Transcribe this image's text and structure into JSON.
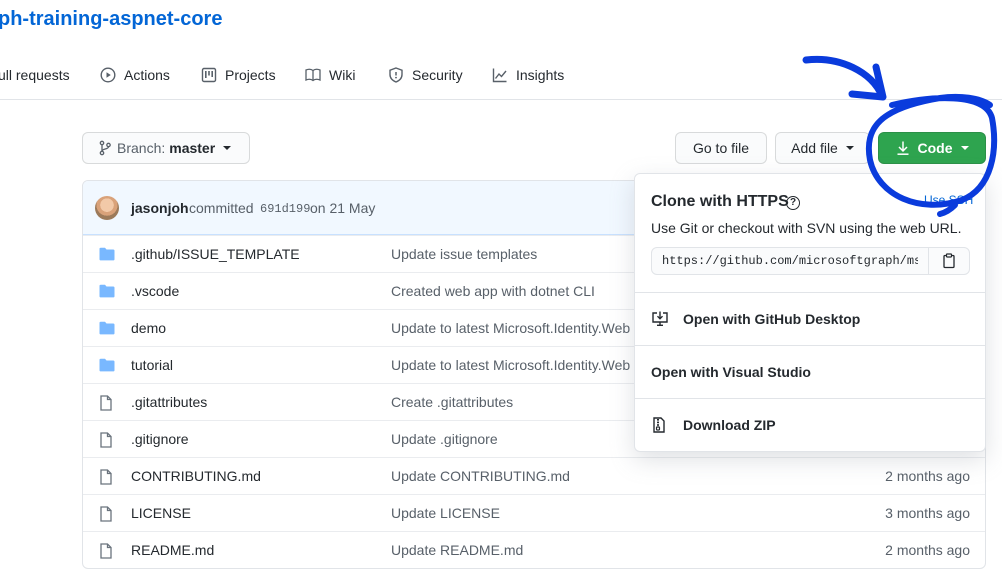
{
  "repo": {
    "title": "ph-training-aspnet-core"
  },
  "nav": {
    "tabs": [
      {
        "label": "ull requests"
      },
      {
        "label": "Actions"
      },
      {
        "label": "Projects"
      },
      {
        "label": "Wiki"
      },
      {
        "label": "Security"
      },
      {
        "label": "Insights"
      }
    ]
  },
  "toolbar": {
    "branch_label": "Branch:",
    "branch_value": "master",
    "goto_file": "Go to file",
    "add_file": "Add file",
    "code": "Code"
  },
  "commit": {
    "author": "jasonjoh",
    "text": "committed",
    "sha": "691d199",
    "date": "on 21 May"
  },
  "files": [
    {
      "name": ".github/ISSUE_TEMPLATE",
      "type": "folder",
      "message": "Update issue templates",
      "age": ""
    },
    {
      "name": ".vscode",
      "type": "folder",
      "message": "Created web app with dotnet CLI",
      "age": ""
    },
    {
      "name": "demo",
      "type": "folder",
      "message": "Update to latest Microsoft.Identity.Web",
      "age": ""
    },
    {
      "name": "tutorial",
      "type": "folder",
      "message": "Update to latest Microsoft.Identity.Web",
      "age": ""
    },
    {
      "name": ".gitattributes",
      "type": "file",
      "message": "Create .gitattributes",
      "age": ""
    },
    {
      "name": ".gitignore",
      "type": "file",
      "message": "Update .gitignore",
      "age": ""
    },
    {
      "name": "CONTRIBUTING.md",
      "type": "file",
      "message": "Update CONTRIBUTING.md",
      "age": "2 months ago"
    },
    {
      "name": "LICENSE",
      "type": "file",
      "message": "Update LICENSE",
      "age": "3 months ago"
    },
    {
      "name": "README.md",
      "type": "file",
      "message": "Update README.md",
      "age": "2 months ago"
    }
  ],
  "clone": {
    "title": "Clone with HTTPS",
    "help": "?",
    "use_ssh": "Use SSH",
    "description": "Use Git or checkout with SVN using the web URL.",
    "url": "https://github.com/microsoftgraph/msgraph-training-aspnet-core.git",
    "options": [
      {
        "label": "Open with GitHub Desktop",
        "icon": "desktop-download-icon"
      },
      {
        "label": "Open with Visual Studio",
        "icon": ""
      },
      {
        "label": "Download ZIP",
        "icon": "file-zip-icon"
      }
    ]
  },
  "colors": {
    "link": "#0366d6",
    "code_button": "#2ea44f",
    "folder_icon": "#79b8ff",
    "annotation_ink": "#0a3bdc"
  }
}
